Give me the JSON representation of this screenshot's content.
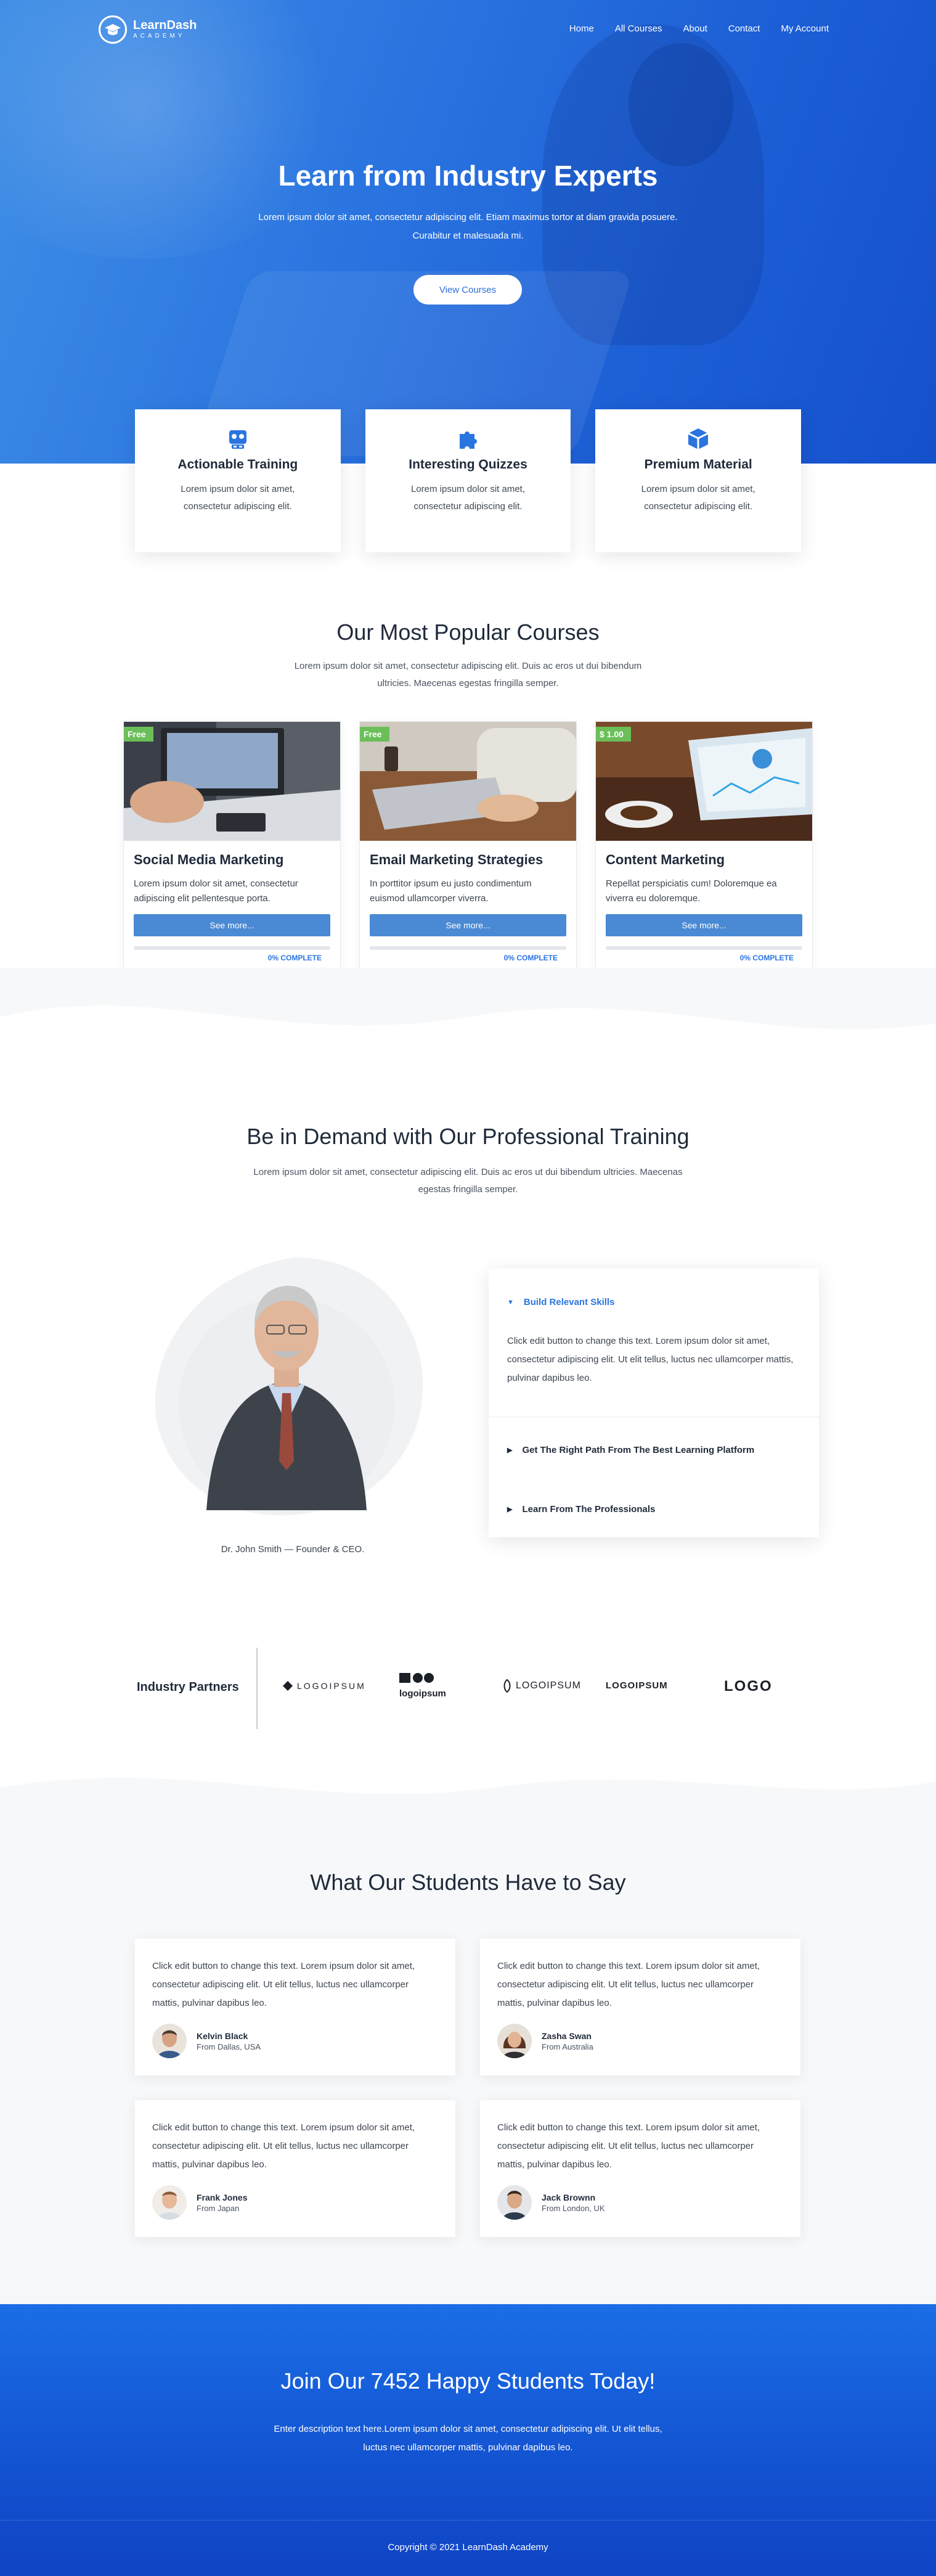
{
  "brand": {
    "name": "LearnDash",
    "tagline": "ACADEMY"
  },
  "nav": {
    "items": [
      "Home",
      "All Courses",
      "About",
      "Contact",
      "My Account"
    ]
  },
  "hero": {
    "title": "Learn from Industry Experts",
    "subtitle": "Lorem ipsum dolor sit amet, consectetur adipiscing elit. Etiam maximus tortor at diam gravida posuere. Curabitur et malesuada mi.",
    "button": "View Courses"
  },
  "features": [
    {
      "icon": "robot-icon",
      "title": "Actionable Training",
      "text": "Lorem ipsum dolor sit amet, consectetur adipiscing elit."
    },
    {
      "icon": "puzzle-icon",
      "title": "Interesting Quizzes",
      "text": "Lorem ipsum dolor sit amet, consectetur adipiscing elit."
    },
    {
      "icon": "cube-icon",
      "title": "Premium Material",
      "text": "Lorem ipsum dolor sit amet, consectetur adipiscing elit."
    }
  ],
  "courses_section": {
    "title": "Our Most Popular Courses",
    "subtitle": "Lorem ipsum dolor sit amet, consectetur adipiscing elit. Duis ac eros ut dui bibendum ultricies. Maecenas egestas fringilla semper."
  },
  "courses": [
    {
      "badge": "Free",
      "title": "Social Media Marketing",
      "text": "Lorem ipsum dolor sit amet, consectetur adipiscing elit pellentesque porta.",
      "button": "See more...",
      "progress": 0,
      "progress_label": "0% COMPLETE"
    },
    {
      "badge": "Free",
      "title": "Email Marketing Strategies",
      "text": "In porttitor ipsum eu justo condimentum euismod ullamcorper viverra.",
      "button": "See more...",
      "progress": 0,
      "progress_label": "0% COMPLETE"
    },
    {
      "badge": "$ 1.00",
      "title": "Content Marketing",
      "text": "Repellat perspiciatis cum! Doloremque ea viverra eu doloremque.",
      "button": "See more...",
      "progress": 0,
      "progress_label": "0% COMPLETE"
    }
  ],
  "training": {
    "title": "Be in Demand with Our Professional Training",
    "subtitle": "Lorem ipsum dolor sit amet, consectetur adipiscing elit. Duis ac eros ut dui bibendum ultricies. Maecenas egestas fringilla semper.",
    "caption": "Dr. John Smith — Founder & CEO.",
    "accordion": [
      {
        "title": "Build Relevant Skills",
        "open": true,
        "body": "Click edit button to change this text. Lorem ipsum dolor sit amet, consectetur adipiscing elit. Ut elit tellus, luctus nec ullamcorper mattis, pulvinar dapibus leo."
      },
      {
        "title": "Get The Right Path From The Best Learning Platform",
        "open": false
      },
      {
        "title": "Learn From The Professionals",
        "open": false
      }
    ]
  },
  "partners": {
    "title": "Industry Partners",
    "logos": [
      "LOGOIPSUM",
      "logoipsum",
      "LOGOIPSUM",
      "LOGOIPSUM",
      "LOGO"
    ]
  },
  "testimonials": {
    "title": "What Our Students Have to Say",
    "items": [
      {
        "text": "Click edit button to change this text. Lorem ipsum dolor sit amet, consectetur adipiscing elit. Ut elit tellus, luctus nec ullamcorper mattis, pulvinar dapibus leo.",
        "name": "Kelvin Black",
        "from": "From Dallas, USA"
      },
      {
        "text": "Click edit button to change this text. Lorem ipsum dolor sit amet, consectetur adipiscing elit. Ut elit tellus, luctus nec ullamcorper mattis, pulvinar dapibus leo.",
        "name": "Zasha Swan",
        "from": "From Australia"
      },
      {
        "text": "Click edit button to change this text. Lorem ipsum dolor sit amet, consectetur adipiscing elit. Ut elit tellus, luctus nec ullamcorper mattis, pulvinar dapibus leo.",
        "name": "Frank Jones",
        "from": "From Japan"
      },
      {
        "text": "Click edit button to change this text. Lorem ipsum dolor sit amet, consectetur adipiscing elit. Ut elit tellus, luctus nec ullamcorper mattis, pulvinar dapibus leo.",
        "name": "Jack Brownn",
        "from": "From London, UK"
      }
    ]
  },
  "cta": {
    "title": "Join Our 7452 Happy Students Today!",
    "text": "Enter description text here.Lorem ipsum dolor sit amet, consectetur adipiscing elit. Ut elit tellus, luctus nec ullamcorper mattis, pulvinar dapibus leo."
  },
  "footer": {
    "copyright": "Copyright © 2021 LearnDash Academy"
  },
  "colors": {
    "primary": "#2a74e0",
    "button": "#4a8ad4",
    "badge": "#6bbf59",
    "dark": "#1f2a3a"
  }
}
